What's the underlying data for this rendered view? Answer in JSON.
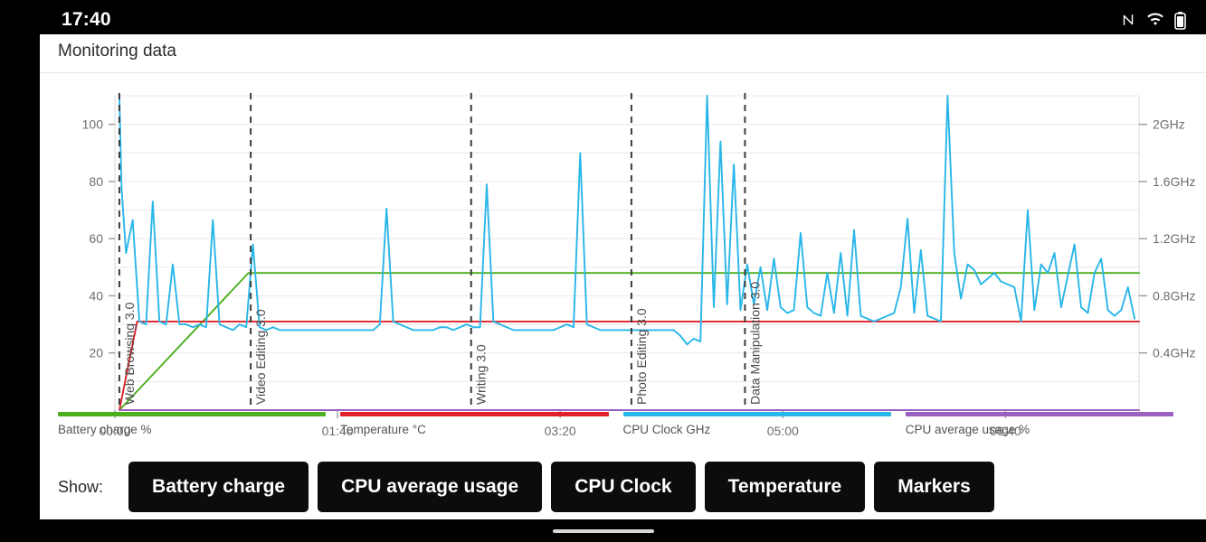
{
  "statusbar": {
    "clock": "17:40",
    "icons": [
      {
        "name": "nfc-icon",
        "label": "N"
      },
      {
        "name": "wifi-icon",
        "label": "wifi"
      },
      {
        "name": "battery-icon",
        "label": "battery"
      }
    ]
  },
  "app": {
    "title": "Monitoring data"
  },
  "legend": [
    {
      "label": "Battery charge %",
      "color": "#4caf1e"
    },
    {
      "label": "Temperature °C",
      "color": "#e02129"
    },
    {
      "label": "CPU Clock GHz",
      "color": "#29b6e8"
    },
    {
      "label": "CPU average usage %",
      "color": "#9b5fc0"
    }
  ],
  "controls": {
    "show_label": "Show:",
    "buttons": [
      {
        "label": "Battery charge",
        "name": "toggle-battery-charge"
      },
      {
        "label": "CPU average usage",
        "name": "toggle-cpu-average-usage"
      },
      {
        "label": "CPU Clock",
        "name": "toggle-cpu-clock"
      },
      {
        "label": "Temperature",
        "name": "toggle-temperature"
      },
      {
        "label": "Markers",
        "name": "toggle-markers"
      }
    ]
  },
  "chart_data": {
    "type": "line",
    "title": "Monitoring data",
    "xlabel": "",
    "ylabel": "",
    "grid": true,
    "legend_position": "bottom",
    "x_ticks": [
      "00:00",
      "01:40",
      "03:20",
      "05:00",
      "06:40"
    ],
    "x_tick_values": [
      0,
      100,
      200,
      300,
      400
    ],
    "xlim": [
      0,
      460
    ],
    "left_axis": {
      "ticks": [
        20,
        40,
        60,
        80,
        100
      ],
      "tick_labels": [
        "20",
        "40",
        "60",
        "80",
        "100"
      ],
      "ylim": [
        0,
        110
      ]
    },
    "right_axis": {
      "ticks": [
        0.4,
        0.8,
        1.2,
        1.6,
        2.0
      ],
      "tick_labels": [
        "0.4GHz",
        "0.8GHz",
        "1.2GHz",
        "1.6GHz",
        "2GHz"
      ],
      "ylim": [
        0,
        2.2
      ]
    },
    "markers": [
      {
        "label": "Web Browsing 3.0",
        "x": 2
      },
      {
        "label": "Video Editing 3.0",
        "x": 61
      },
      {
        "label": "Writing 3.0",
        "x": 160
      },
      {
        "label": "Photo Editing 3.0",
        "x": 232
      },
      {
        "label": "Data Manipulation 3.0",
        "x": 283
      }
    ],
    "series": [
      {
        "name": "Battery charge %",
        "color": "#4caf1e",
        "axis": "left",
        "unit": "%",
        "x": [
          2,
          60,
          61,
          160,
          232,
          283,
          284,
          460
        ],
        "values": [
          0,
          48,
          48,
          48,
          48,
          48,
          48,
          48
        ]
      },
      {
        "name": "Temperature °C",
        "color": "#e02129",
        "axis": "left",
        "unit": "°C",
        "x": [
          2,
          10,
          60,
          120,
          160,
          200,
          232,
          283,
          290,
          360,
          460
        ],
        "values": [
          0,
          31,
          31,
          31,
          31,
          31,
          31,
          31,
          31,
          31,
          31
        ]
      },
      {
        "name": "CPU average usage %",
        "color": "#9b5fc0",
        "axis": "left",
        "unit": "%",
        "x": [
          2,
          100,
          200,
          300,
          400,
          460
        ],
        "values": [
          0,
          0,
          0,
          0,
          0,
          0
        ]
      },
      {
        "name": "CPU Clock GHz",
        "color": "#29b6e8",
        "axis": "right",
        "unit": "GHz",
        "x": [
          2,
          3,
          5,
          8,
          11,
          14,
          17,
          20,
          23,
          26,
          29,
          32,
          35,
          38,
          41,
          44,
          47,
          50,
          53,
          56,
          59,
          62,
          65,
          68,
          71,
          74,
          77,
          80,
          83,
          86,
          89,
          92,
          95,
          98,
          101,
          104,
          107,
          110,
          113,
          116,
          119,
          122,
          125,
          128,
          131,
          134,
          137,
          140,
          143,
          146,
          149,
          152,
          155,
          158,
          161,
          164,
          167,
          170,
          173,
          176,
          179,
          182,
          185,
          188,
          191,
          194,
          197,
          200,
          203,
          206,
          209,
          212,
          215,
          218,
          221,
          224,
          227,
          230,
          233,
          236,
          239,
          242,
          245,
          248,
          251,
          254,
          257,
          260,
          263,
          266,
          269,
          272,
          275,
          278,
          281,
          284,
          287,
          290,
          293,
          296,
          299,
          302,
          305,
          308,
          311,
          314,
          317,
          320,
          323,
          326,
          329,
          332,
          335,
          338,
          341,
          344,
          347,
          350,
          353,
          356,
          359,
          362,
          365,
          368,
          371,
          374,
          377,
          380,
          383,
          386,
          389,
          392,
          395,
          398,
          401,
          404,
          407,
          410,
          413,
          416,
          419,
          422,
          425,
          428,
          431,
          434,
          437,
          440,
          443,
          446,
          449,
          452,
          455,
          458
        ],
        "values": [
          2.2,
          1.55,
          1.1,
          1.33,
          0.62,
          0.6,
          1.46,
          0.62,
          0.6,
          1.02,
          0.6,
          0.6,
          0.58,
          0.6,
          0.58,
          1.33,
          0.6,
          0.58,
          0.56,
          0.6,
          0.58,
          1.16,
          0.58,
          0.56,
          0.58,
          0.56,
          0.56,
          0.56,
          0.56,
          0.56,
          0.56,
          0.56,
          0.56,
          0.56,
          0.56,
          0.56,
          0.56,
          0.56,
          0.56,
          0.56,
          0.6,
          1.41,
          0.62,
          0.6,
          0.58,
          0.56,
          0.56,
          0.56,
          0.56,
          0.58,
          0.58,
          0.56,
          0.58,
          0.6,
          0.58,
          0.58,
          1.58,
          0.62,
          0.6,
          0.58,
          0.56,
          0.56,
          0.56,
          0.56,
          0.56,
          0.56,
          0.56,
          0.58,
          0.6,
          0.58,
          1.8,
          0.6,
          0.58,
          0.56,
          0.56,
          0.56,
          0.56,
          0.56,
          0.56,
          0.56,
          0.56,
          0.56,
          0.56,
          0.56,
          0.56,
          0.52,
          0.46,
          0.5,
          0.48,
          2.2,
          0.72,
          1.88,
          0.74,
          1.72,
          0.7,
          1.02,
          0.74,
          1.0,
          0.7,
          1.06,
          0.72,
          0.68,
          0.7,
          1.24,
          0.72,
          0.68,
          0.66,
          0.96,
          0.68,
          1.1,
          0.66,
          1.26,
          0.66,
          0.64,
          0.62,
          0.64,
          0.66,
          0.68,
          0.86,
          1.34,
          0.68,
          1.12,
          0.66,
          0.64,
          0.62,
          2.2,
          1.1,
          0.78,
          1.02,
          0.98,
          0.88,
          0.92,
          0.96,
          0.9,
          0.88,
          0.86,
          0.62,
          1.4,
          0.7,
          1.02,
          0.96,
          1.1,
          0.72,
          0.94,
          1.16,
          0.72,
          0.68,
          0.96,
          1.06,
          0.7,
          0.66,
          0.7,
          0.86,
          0.64,
          1.48,
          0.72,
          1.44,
          0.66,
          0.9,
          0.86,
          0.72,
          0.78,
          0.7,
          0.72,
          0.72
        ]
      }
    ]
  }
}
